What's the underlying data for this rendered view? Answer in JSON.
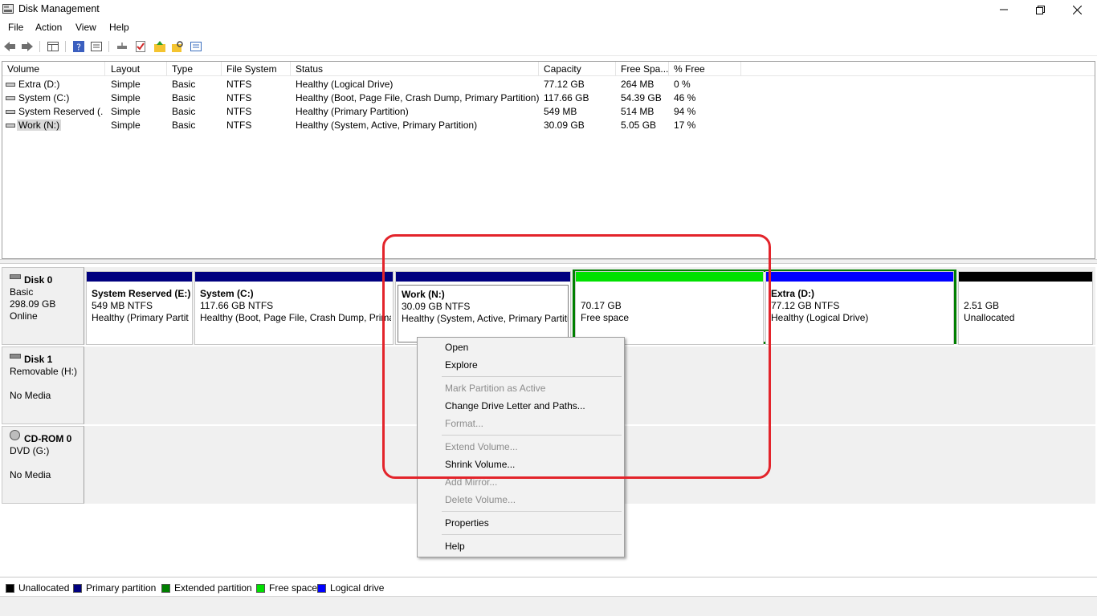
{
  "window": {
    "title": "Disk Management"
  },
  "menu": [
    "File",
    "Action",
    "View",
    "Help"
  ],
  "toolbar_icons": [
    "back-arrow-icon",
    "forward-arrow-icon",
    "console-tree-icon",
    "help-icon",
    "properties-icon",
    "connect-icon",
    "checklist-icon",
    "folder-up-icon",
    "folder-search-icon",
    "settings-list-icon"
  ],
  "volume_list": {
    "columns": [
      "Volume",
      "Layout",
      "Type",
      "File System",
      "Status",
      "Capacity",
      "Free Spa...",
      "% Free"
    ],
    "rows": [
      [
        "Extra (D:)",
        "Simple",
        "Basic",
        "NTFS",
        "Healthy (Logical Drive)",
        "77.12 GB",
        "264 MB",
        "0 %"
      ],
      [
        "System (C:)",
        "Simple",
        "Basic",
        "NTFS",
        "Healthy (Boot, Page File, Crash Dump, Primary Partition)",
        "117.66 GB",
        "54.39 GB",
        "46 %"
      ],
      [
        "System Reserved (...",
        "Simple",
        "Basic",
        "NTFS",
        "Healthy (Primary Partition)",
        "549 MB",
        "514 MB",
        "94 %"
      ],
      [
        "Work (N:)",
        "Simple",
        "Basic",
        "NTFS",
        "Healthy (System, Active, Primary Partition)",
        "30.09 GB",
        "5.05 GB",
        "17 %"
      ]
    ]
  },
  "disks": [
    {
      "name": "Disk 0",
      "type": "Basic",
      "size": "298.09 GB",
      "status": "Online",
      "partitions": [
        {
          "name": "System Reserved  (E:)",
          "size": "549 MB NTFS",
          "status": "Healthy (Primary Partit",
          "bar": "#00007f"
        },
        {
          "name": "System  (C:)",
          "size": "117.66 GB NTFS",
          "status": "Healthy (Boot, Page File, Crash Dump, Prima",
          "bar": "#00007f"
        },
        {
          "name": "Work  (N:)",
          "size": "30.09 GB NTFS",
          "status": "Healthy (System, Active, Primary Partiti",
          "bar": "#00007f"
        },
        {
          "name": "",
          "size": "70.17 GB",
          "status": "Free space",
          "bar": "#00e000"
        },
        {
          "name": "Extra  (D:)",
          "size": "77.12 GB NTFS",
          "status": "Healthy (Logical Drive)",
          "bar": "#0000ff"
        },
        {
          "name": "",
          "size": "2.51 GB",
          "status": "Unallocated",
          "bar": "#000000"
        }
      ]
    },
    {
      "name": "Disk 1",
      "type": "Removable (H:)",
      "status": "No Media"
    },
    {
      "name": "CD-ROM 0",
      "type": "DVD (G:)",
      "status": "No Media"
    }
  ],
  "context_menu": [
    {
      "label": "Open",
      "enabled": true
    },
    {
      "label": "Explore",
      "enabled": true
    },
    {
      "label": "Mark Partition as Active",
      "enabled": false
    },
    {
      "label": "Change Drive Letter and Paths...",
      "enabled": true
    },
    {
      "label": "Format...",
      "enabled": false
    },
    {
      "label": "Extend Volume...",
      "enabled": false
    },
    {
      "label": "Shrink Volume...",
      "enabled": true
    },
    {
      "label": "Add Mirror...",
      "enabled": false
    },
    {
      "label": "Delete Volume...",
      "enabled": false
    },
    {
      "label": "Properties",
      "enabled": true
    },
    {
      "label": "Help",
      "enabled": true
    }
  ],
  "legend": [
    {
      "label": "Unallocated",
      "color": "#000000"
    },
    {
      "label": "Primary partition",
      "color": "#00007f"
    },
    {
      "label": "Extended partition",
      "color": "#007f00"
    },
    {
      "label": "Free space",
      "color": "#00e000"
    },
    {
      "label": "Logical drive",
      "color": "#0000ff"
    }
  ],
  "colors": {
    "annotation": "#e3242b",
    "extended_outline": "#007f00"
  }
}
